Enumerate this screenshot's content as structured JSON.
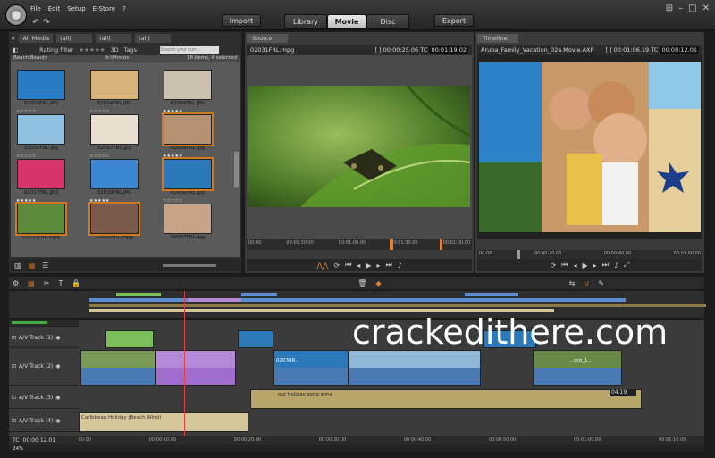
{
  "menu": [
    "File",
    "Edit",
    "Setup",
    "E-Store",
    "?"
  ],
  "tabs": {
    "import": "Import",
    "library": "Library",
    "movie": "Movie",
    "disc": "Disc",
    "export": "Export"
  },
  "library": {
    "all_media": "All Media",
    "rating_filter": "Rating filter",
    "rating_stars": "★★★★★",
    "filter_3d": "3D",
    "tags": "Tags",
    "search_placeholder": "Search your curr...",
    "crumb_all_1": "(all)",
    "crumb_all_2": "(all)",
    "crumb_all_3": "(all)",
    "collection": "Beach Beauty",
    "subfolder": "b:\\Photos",
    "count": "18 items, 4 selected",
    "items": [
      {
        "label": "02003FRL.JPG",
        "color": "#2a7cc4",
        "stars": "",
        "selected": false
      },
      {
        "label": "02004FRL.JPG",
        "color": "#d9b47a",
        "stars": "",
        "selected": false
      },
      {
        "label": "02005FRL.JPG",
        "color": "#cbbfae",
        "stars": "",
        "selected": false
      },
      {
        "label": "02006FRL.jpg",
        "color": "#8fc1e2",
        "stars": "☆☆☆☆☆",
        "selected": false
      },
      {
        "label": "02007FRL.jpg",
        "color": "#e9e0d2",
        "stars": "☆☆☆☆☆",
        "selected": false
      },
      {
        "label": "02008FRL.jpg",
        "color": "#b49272",
        "stars": "★★★★★",
        "selected": true
      },
      {
        "label": "02017FRL.JPG",
        "color": "#d8356a",
        "stars": "☆☆☆☆☆",
        "selected": false
      },
      {
        "label": "02029FRL.JPG",
        "color": "#3b87d1",
        "stars": "☆☆☆☆☆",
        "selected": false
      },
      {
        "label": "02030FRL.jpg",
        "color": "#2b79b9",
        "stars": "★★★★★",
        "selected": true
      },
      {
        "label": "02031FRL.mpg",
        "color": "#5b8a3a",
        "stars": "★★★★★",
        "selected": true
      },
      {
        "label": "02055FRL.mpg",
        "color": "#7a5a4a",
        "stars": "★★★★★",
        "selected": true
      },
      {
        "label": "02057FRL.jpg",
        "color": "#c7a487",
        "stars": "☆☆☆☆☆",
        "selected": false
      }
    ]
  },
  "source": {
    "tab": "Source",
    "file": "02031FRL.mpg",
    "duration": "[ ] 00:00:25.06",
    "tc_label": "TC",
    "tc": "00:01:19.02",
    "ticks": [
      "00:00",
      "00:00:30.00",
      "00:01:00.00",
      "00:01:30.00",
      "00:02:00.00"
    ]
  },
  "timeline_mon": {
    "tab": "Timeline",
    "file": "Aruba_Family_Vacation_02a.Movie.AXP",
    "duration": "[ ] 00:01:06.19",
    "tc_label": "TC",
    "tc": "00:00:12.01",
    "ticks": [
      "00:00",
      "00:00:20.00",
      "00:00:40.00",
      "00:01:00.00"
    ]
  },
  "tracks": [
    {
      "name": "A/V Track (1)"
    },
    {
      "name": "A/V Track (2)"
    },
    {
      "name": "A/V Track (3)"
    },
    {
      "name": "A/V Track (4)"
    }
  ],
  "clips": {
    "track2_title": "02030R...",
    "track2_title2": "...mg_1...",
    "track3_title": "our holiday song.wma",
    "track3_tc": "04.19",
    "track4_title": "Caribbean Holiday (Beach Wind)"
  },
  "footer": {
    "tc_label": "TC",
    "tc": "00:00:12.01",
    "zoom": "24%",
    "ticks": [
      "00:00",
      "00:00:10.00",
      "00:00:20.00",
      "00:00:30.00",
      "00:00:40.00",
      "00:00:50.00",
      "00:01:00.00",
      "00:01:10.00"
    ]
  },
  "watermark": "crackedithere.com"
}
